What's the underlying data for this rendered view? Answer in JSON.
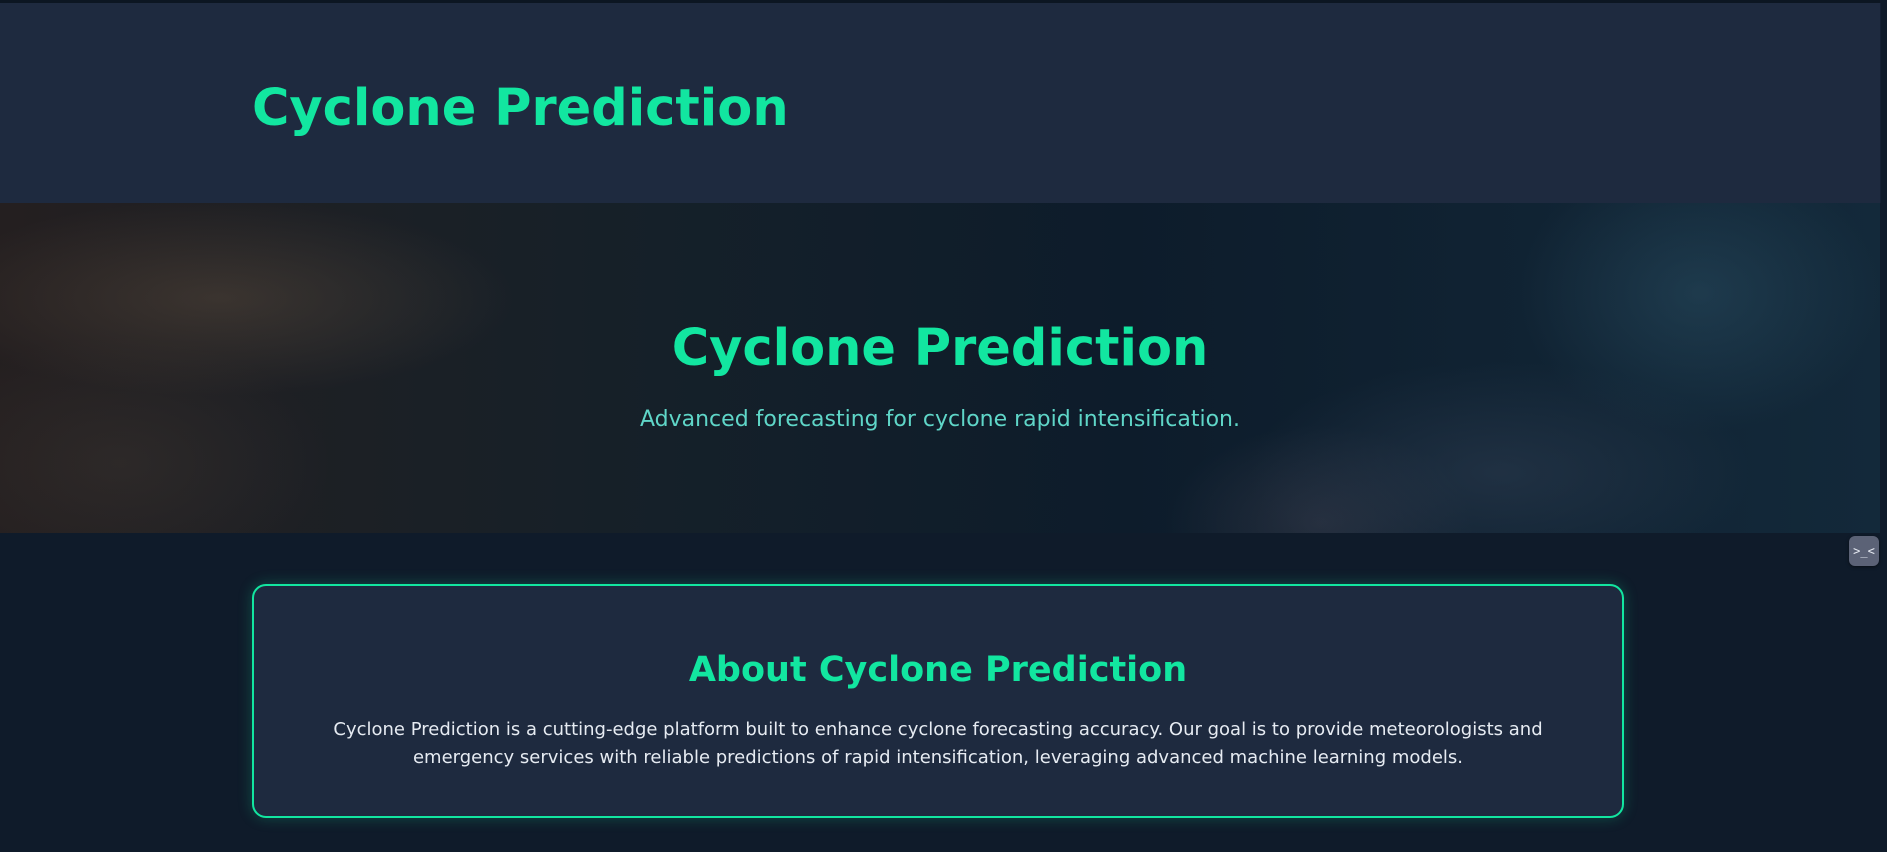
{
  "header": {
    "title": "Cyclone Prediction"
  },
  "hero": {
    "title": "Cyclone Prediction",
    "subtitle": "Advanced forecasting for cyclone rapid intensification."
  },
  "side_widget": {
    "icon": "face-icon",
    "glyph": ">_<"
  },
  "about": {
    "title": "About Cyclone Prediction",
    "text": "Cyclone Prediction is a cutting-edge platform built to enhance cyclone forecasting accuracy. Our goal is to provide meteorologists and emergency services with reliable predictions of rapid intensification, leveraging advanced machine learning models."
  },
  "colors": {
    "accent": "#12e6a0",
    "subtitle": "#5fd6c8",
    "header_bg": "#1e2a3f",
    "page_bg": "#0f1b2a",
    "card_text": "#e6ebf2"
  }
}
